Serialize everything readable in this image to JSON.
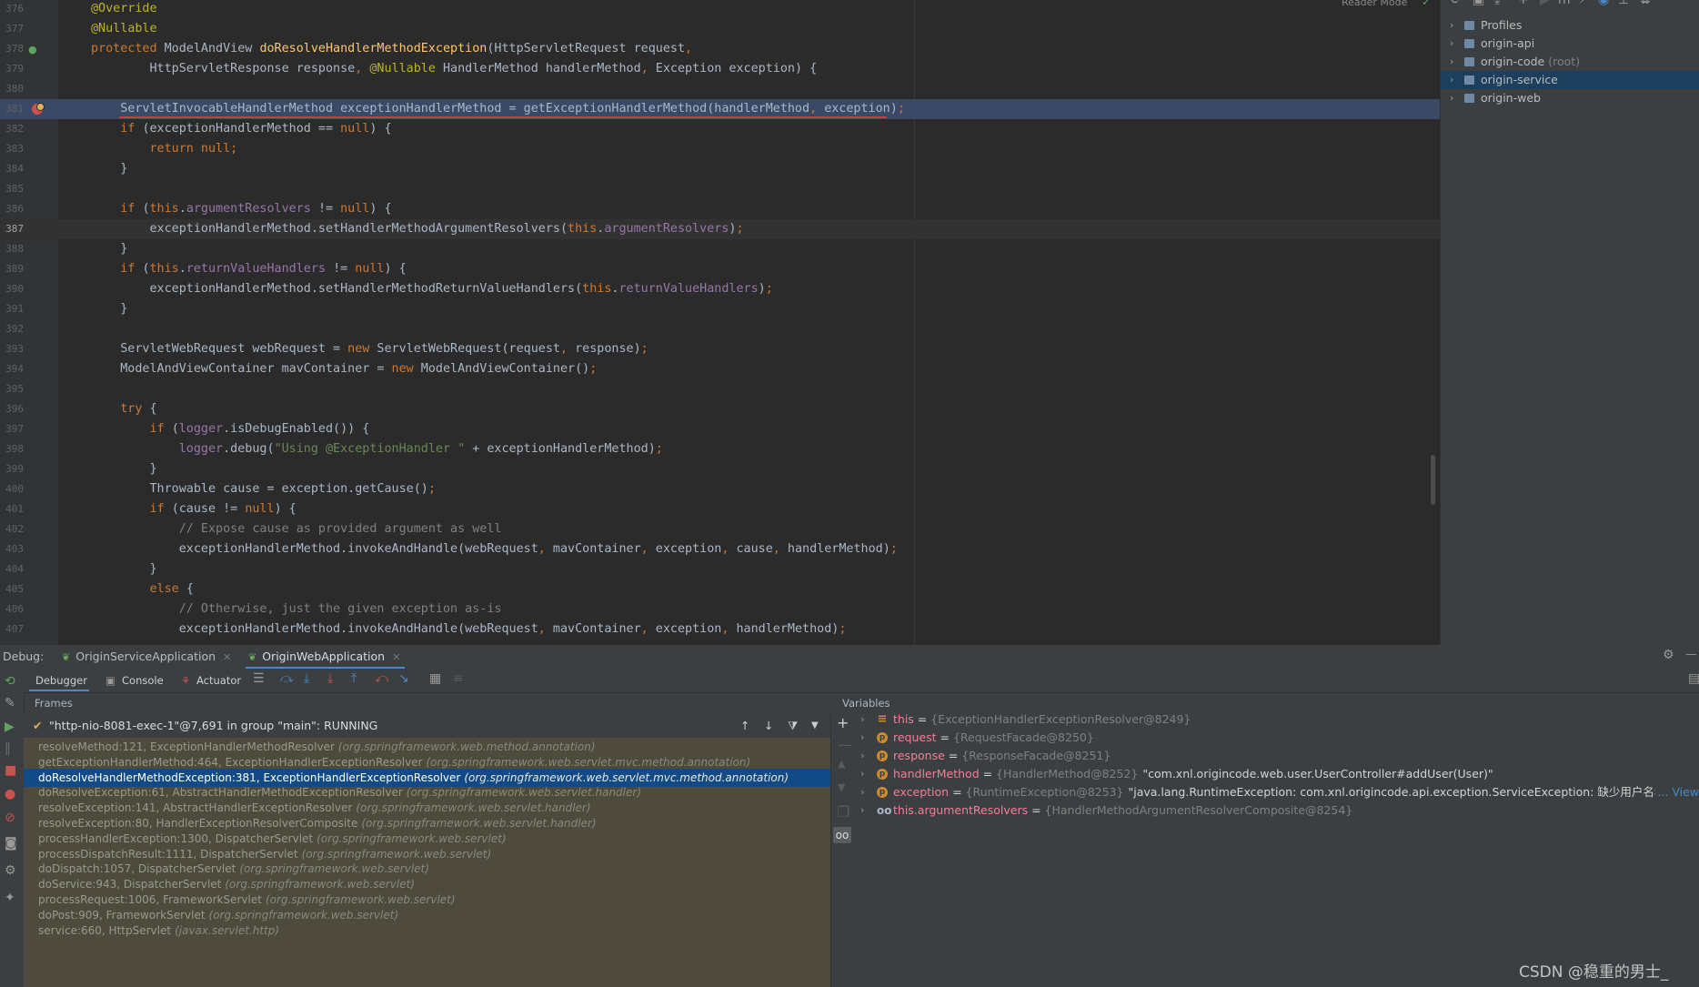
{
  "editor": {
    "reader_mode": "Reader Mode",
    "lines": [
      {
        "n": "376",
        "tokens": [
          [
            "an",
            "@Override"
          ]
        ]
      },
      {
        "n": "377",
        "tokens": [
          [
            "an",
            "@Nullable"
          ]
        ]
      },
      {
        "n": "378",
        "tokens": [
          [
            "kw",
            "protected "
          ],
          [
            "pl",
            "ModelAndView "
          ],
          [
            "fn",
            "doResolveHandlerMethodException"
          ],
          [
            "pl",
            "(HttpServletRequest request"
          ],
          [
            "kw",
            ","
          ]
        ]
      },
      {
        "n": "379",
        "tokens": [
          [
            "pl",
            "        HttpServletResponse response"
          ],
          [
            "kw",
            ", "
          ],
          [
            "an",
            "@Nullable "
          ],
          [
            "pl",
            "HandlerMethod handlerMethod"
          ],
          [
            "kw",
            ", "
          ],
          [
            "pl",
            "Exception exception) {"
          ]
        ]
      },
      {
        "n": "380",
        "tokens": []
      },
      {
        "n": "381",
        "tokens": [
          [
            "pl",
            "    ServletInvocableHandlerMethod exceptionHandlerMethod = getExceptionHandlerMethod(handlerMethod"
          ],
          [
            "kw",
            ", "
          ],
          [
            "pl",
            "exception)"
          ],
          [
            "kw",
            ";"
          ]
        ]
      },
      {
        "n": "382",
        "tokens": [
          [
            "kw",
            "    if "
          ],
          [
            "pl",
            "(exceptionHandlerMethod == "
          ],
          [
            "kw",
            "null"
          ],
          [
            "pl",
            ") {"
          ]
        ]
      },
      {
        "n": "383",
        "tokens": [
          [
            "kw",
            "        return null;"
          ]
        ]
      },
      {
        "n": "384",
        "tokens": [
          [
            "pl",
            "    }"
          ]
        ]
      },
      {
        "n": "385",
        "tokens": []
      },
      {
        "n": "386",
        "tokens": [
          [
            "kw",
            "    if "
          ],
          [
            "pl",
            "("
          ],
          [
            "kw",
            "this"
          ],
          [
            "pl",
            "."
          ],
          [
            "fld",
            "argumentResolvers "
          ],
          [
            "pl",
            "!= "
          ],
          [
            "kw",
            "null"
          ],
          [
            "pl",
            ") {"
          ]
        ]
      },
      {
        "n": "387",
        "tokens": [
          [
            "pl",
            "        exceptionHandlerMethod.setHandlerMethodArgumentResolvers("
          ],
          [
            "kw",
            "this"
          ],
          [
            "pl",
            "."
          ],
          [
            "fld",
            "argumentResolvers"
          ],
          [
            "pl",
            ")"
          ],
          [
            "kw",
            ";"
          ]
        ]
      },
      {
        "n": "388",
        "tokens": [
          [
            "pl",
            "    }"
          ]
        ]
      },
      {
        "n": "389",
        "tokens": [
          [
            "kw",
            "    if "
          ],
          [
            "pl",
            "("
          ],
          [
            "kw",
            "this"
          ],
          [
            "pl",
            "."
          ],
          [
            "fld",
            "returnValueHandlers "
          ],
          [
            "pl",
            "!= "
          ],
          [
            "kw",
            "null"
          ],
          [
            "pl",
            ") {"
          ]
        ]
      },
      {
        "n": "390",
        "tokens": [
          [
            "pl",
            "        exceptionHandlerMethod.setHandlerMethodReturnValueHandlers("
          ],
          [
            "kw",
            "this"
          ],
          [
            "pl",
            "."
          ],
          [
            "fld",
            "returnValueHandlers"
          ],
          [
            "pl",
            ")"
          ],
          [
            "kw",
            ";"
          ]
        ]
      },
      {
        "n": "391",
        "tokens": [
          [
            "pl",
            "    }"
          ]
        ]
      },
      {
        "n": "392",
        "tokens": []
      },
      {
        "n": "393",
        "tokens": [
          [
            "pl",
            "    ServletWebRequest webRequest = "
          ],
          [
            "kw",
            "new "
          ],
          [
            "pl",
            "ServletWebRequest(request"
          ],
          [
            "kw",
            ", "
          ],
          [
            "pl",
            "response)"
          ],
          [
            "kw",
            ";"
          ]
        ]
      },
      {
        "n": "394",
        "tokens": [
          [
            "pl",
            "    ModelAndViewContainer mavContainer = "
          ],
          [
            "kw",
            "new "
          ],
          [
            "pl",
            "ModelAndViewContainer()"
          ],
          [
            "kw",
            ";"
          ]
        ]
      },
      {
        "n": "395",
        "tokens": []
      },
      {
        "n": "396",
        "tokens": [
          [
            "kw",
            "    try "
          ],
          [
            "pl",
            "{"
          ]
        ]
      },
      {
        "n": "397",
        "tokens": [
          [
            "kw",
            "        if "
          ],
          [
            "pl",
            "("
          ],
          [
            "fld",
            "logger"
          ],
          [
            "pl",
            ".isDebugEnabled()) {"
          ]
        ]
      },
      {
        "n": "398",
        "tokens": [
          [
            "fld",
            "            logger"
          ],
          [
            "pl",
            ".debug("
          ],
          [
            "str",
            "\"Using @ExceptionHandler \" "
          ],
          [
            "pl",
            "+ exceptionHandlerMethod)"
          ],
          [
            "kw",
            ";"
          ]
        ]
      },
      {
        "n": "399",
        "tokens": [
          [
            "pl",
            "        }"
          ]
        ]
      },
      {
        "n": "400",
        "tokens": [
          [
            "pl",
            "        Throwable cause = exception.getCause()"
          ],
          [
            "kw",
            ";"
          ]
        ]
      },
      {
        "n": "401",
        "tokens": [
          [
            "kw",
            "        if "
          ],
          [
            "pl",
            "(cause != "
          ],
          [
            "kw",
            "null"
          ],
          [
            "pl",
            ") {"
          ]
        ]
      },
      {
        "n": "402",
        "tokens": [
          [
            "cm",
            "            // Expose cause as provided argument as well"
          ]
        ]
      },
      {
        "n": "403",
        "tokens": [
          [
            "pl",
            "            exceptionHandlerMethod.invokeAndHandle(webRequest"
          ],
          [
            "kw",
            ", "
          ],
          [
            "pl",
            "mavContainer"
          ],
          [
            "kw",
            ", "
          ],
          [
            "pl",
            "exception"
          ],
          [
            "kw",
            ", "
          ],
          [
            "pl",
            "cause"
          ],
          [
            "kw",
            ", "
          ],
          [
            "pl",
            "handlerMethod)"
          ],
          [
            "kw",
            ";"
          ]
        ]
      },
      {
        "n": "404",
        "tokens": [
          [
            "pl",
            "        }"
          ]
        ]
      },
      {
        "n": "405",
        "tokens": [
          [
            "kw",
            "        else "
          ],
          [
            "pl",
            "{"
          ]
        ]
      },
      {
        "n": "406",
        "tokens": [
          [
            "cm",
            "            // Otherwise, just the given exception as-is"
          ]
        ]
      },
      {
        "n": "407",
        "tokens": [
          [
            "pl",
            "            exceptionHandlerMethod.invokeAndHandle(webRequest"
          ],
          [
            "kw",
            ", "
          ],
          [
            "pl",
            "mavContainer"
          ],
          [
            "kw",
            ", "
          ],
          [
            "pl",
            "exception"
          ],
          [
            "kw",
            ", "
          ],
          [
            "pl",
            "handlerMethod)"
          ],
          [
            "kw",
            ";"
          ]
        ]
      }
    ]
  },
  "project": {
    "items": [
      {
        "label": "Profiles",
        "note": ""
      },
      {
        "label": "origin-api",
        "note": ""
      },
      {
        "label": "origin-code",
        "note": "(root)"
      },
      {
        "label": "origin-service",
        "note": ""
      },
      {
        "label": "origin-web",
        "note": ""
      }
    ],
    "selected": 3
  },
  "debug": {
    "label": "Debug:",
    "tabs": [
      "OriginServiceApplication",
      "OriginWebApplication"
    ],
    "toolbar": {
      "debugger": "Debugger",
      "console": "Console",
      "actuator": "Actuator"
    },
    "frames_title": "Frames",
    "variables_title": "Variables",
    "thread": "\"http-nio-8081-exec-1\"@7,691 in group \"main\": RUNNING",
    "frames": [
      {
        "m": "resolveMethod:121, ExceptionHandlerMethodResolver",
        "p": "(org.springframework.web.method.annotation)"
      },
      {
        "m": "getExceptionHandlerMethod:464, ExceptionHandlerExceptionResolver",
        "p": "(org.springframework.web.servlet.mvc.method.annotation)"
      },
      {
        "m": "doResolveHandlerMethodException:381, ExceptionHandlerExceptionResolver",
        "p": "(org.springframework.web.servlet.mvc.method.annotation)"
      },
      {
        "m": "doResolveException:61, AbstractHandlerMethodExceptionResolver",
        "p": "(org.springframework.web.servlet.handler)"
      },
      {
        "m": "resolveException:141, AbstractHandlerExceptionResolver",
        "p": "(org.springframework.web.servlet.handler)"
      },
      {
        "m": "resolveException:80, HandlerExceptionResolverComposite",
        "p": "(org.springframework.web.servlet.handler)"
      },
      {
        "m": "processHandlerException:1300, DispatcherServlet",
        "p": "(org.springframework.web.servlet)"
      },
      {
        "m": "processDispatchResult:1111, DispatcherServlet",
        "p": "(org.springframework.web.servlet)"
      },
      {
        "m": "doDispatch:1057, DispatcherServlet",
        "p": "(org.springframework.web.servlet)"
      },
      {
        "m": "doService:943, DispatcherServlet",
        "p": "(org.springframework.web.servlet)"
      },
      {
        "m": "processRequest:1006, FrameworkServlet",
        "p": "(org.springframework.web.servlet)"
      },
      {
        "m": "doPost:909, FrameworkServlet",
        "p": "(org.springframework.web.servlet)"
      },
      {
        "m": "service:660, HttpServlet",
        "p": "(javax.servlet.http)"
      }
    ],
    "selected_frame": 2,
    "variables": [
      {
        "icon": "eq",
        "name": "this",
        "type": "{ExceptionHandlerExceptionResolver@8249}",
        "value": ""
      },
      {
        "icon": "p",
        "name": "request",
        "type": "{RequestFacade@8250}",
        "value": ""
      },
      {
        "icon": "p",
        "name": "response",
        "type": "{ResponseFacade@8251}",
        "value": ""
      },
      {
        "icon": "p",
        "name": "handlerMethod",
        "type": "{HandlerMethod@8252}",
        "value": "\"com.xnl.origincode.web.user.UserController#addUser(User)\""
      },
      {
        "icon": "p",
        "name": "exception",
        "type": "{RuntimeException@8253}",
        "value": "\"java.lang.RuntimeException: com.xnl.origincode.api.exception.ServiceException: 缺少用户名称\\ncom"
      },
      {
        "icon": "oo",
        "name": "this.argumentResolvers",
        "type": "{HandlerMethodArgumentResolverComposite@8254}",
        "value": ""
      }
    ],
    "view_link": "... View"
  },
  "watermark": "CSDN @稳重的男士_"
}
